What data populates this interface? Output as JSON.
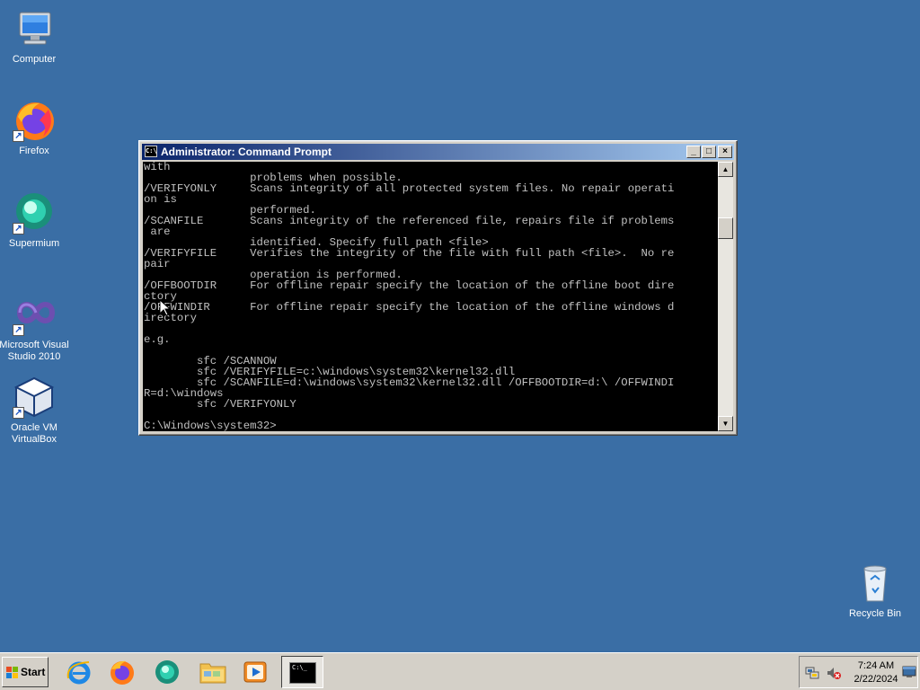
{
  "desktop": {
    "icons": [
      {
        "label": "Computer",
        "icon": "computer-icon"
      },
      {
        "label": "Firefox",
        "icon": "firefox-icon"
      },
      {
        "label": "Supermium",
        "icon": "supermium-icon"
      },
      {
        "label": "Microsoft Visual Studio 2010",
        "icon": "visual-studio-icon"
      },
      {
        "label": "Oracle VM VirtualBox",
        "icon": "virtualbox-icon"
      },
      {
        "label": "Recycle Bin",
        "icon": "recycle-bin-icon"
      }
    ]
  },
  "window": {
    "title": "Administrator: Command Prompt",
    "icon_text": "C:\\",
    "minimize": "_",
    "maximize": "□",
    "close": "×",
    "console_text": "with\n                problems when possible.\n/VERIFYONLY     Scans integrity of all protected system files. No repair operati\non is\n                performed.\n/SCANFILE       Scans integrity of the referenced file, repairs file if problems\n are\n                identified. Specify full path <file>\n/VERIFYFILE     Verifies the integrity of the file with full path <file>.  No re\npair\n                operation is performed.\n/OFFBOOTDIR     For offline repair specify the location of the offline boot dire\nctory\n/OFFWINDIR      For offline repair specify the location of the offline windows d\nirectory\n\ne.g.\n\n        sfc /SCANNOW\n        sfc /VERIFYFILE=c:\\windows\\system32\\kernel32.dll\n        sfc /SCANFILE=d:\\windows\\system32\\kernel32.dll /OFFBOOTDIR=d:\\ /OFFWINDI\nR=d:\\windows\n        sfc /VERIFYONLY\n\nC:\\Windows\\system32>",
    "scroll_up": "▲",
    "scroll_down": "▼"
  },
  "taskbar": {
    "start_label": "Start",
    "apps": [
      {
        "icon": "internet-explorer-icon"
      },
      {
        "icon": "firefox-icon"
      },
      {
        "icon": "supermium-icon"
      },
      {
        "icon": "folder-icon"
      },
      {
        "icon": "media-player-icon"
      },
      {
        "icon": "command-prompt-icon",
        "active": true
      }
    ],
    "active_mini_text": "C:\\_",
    "tray": {
      "time": "7:24 AM",
      "date": "2/22/2024"
    }
  },
  "colors": {
    "desktop": "#3a6ea5",
    "titlebar_start": "#0a246a",
    "titlebar_end": "#a6caf0",
    "console_bg": "#000000",
    "console_fg": "#c0c0c0"
  }
}
